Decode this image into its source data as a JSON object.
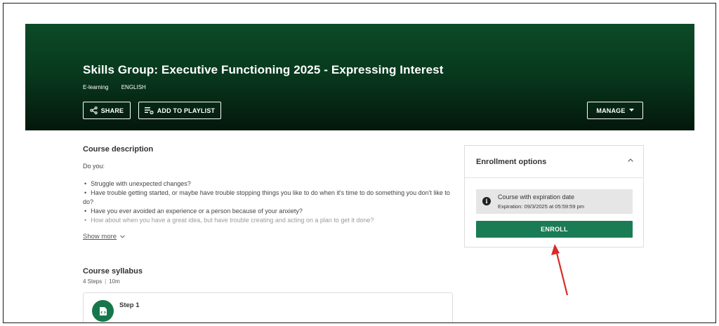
{
  "banner": {
    "title": "Skills Group: Executive Functioning 2025 - Expressing Interest",
    "type": "E-learning",
    "language": "ENGLISH",
    "share_label": "SHARE",
    "playlist_label": "ADD TO PLAYLIST",
    "manage_label": "MANAGE"
  },
  "description": {
    "title": "Course description",
    "intro": "Do you:",
    "bullets": [
      "Struggle with unexpected changes?",
      "Have trouble getting started, or maybe have trouble stopping things you like to do when it's time to do something you don't like to do?",
      "Have you ever avoided an experience or a person because of your anxiety?",
      "How about when you have a great idea, but have trouble creating and acting on a plan to get it done?"
    ],
    "show_more": "Show more"
  },
  "syllabus": {
    "title": "Course syllabus",
    "steps_count": "4 Steps",
    "duration": "10m",
    "step_label": "Step 1"
  },
  "enrollment": {
    "title": "Enrollment options",
    "option_title": "Course with expiration date",
    "option_expiration": "Expiration: 09/3/2025 at 05:59:59 pm",
    "enroll_label": "ENROLL"
  },
  "colors": {
    "banner_dark": "#04170c",
    "banner_green": "#0c4a27",
    "enroll_green": "#1a7c55",
    "annotation_red": "#d62a2a"
  }
}
